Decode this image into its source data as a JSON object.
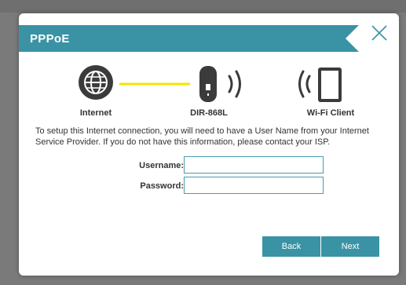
{
  "dialog": {
    "title": "PPPoE"
  },
  "diagram": {
    "internet_label": "Internet",
    "router_label": "DIR-868L",
    "client_label": "Wi-Fi Client"
  },
  "description": "To setup this Internet connection, you will need to have a User Name from your Internet Service Provider. If you do not have this information, please contact your ISP.",
  "form": {
    "username_label": "Username:",
    "username_value": "",
    "password_label": "Password:",
    "password_value": ""
  },
  "buttons": {
    "back": "Back",
    "next": "Next"
  },
  "colors": {
    "accent": "#3a93a5",
    "connection_line": "#f2e600",
    "icon_dark": "#3b3b3b"
  }
}
